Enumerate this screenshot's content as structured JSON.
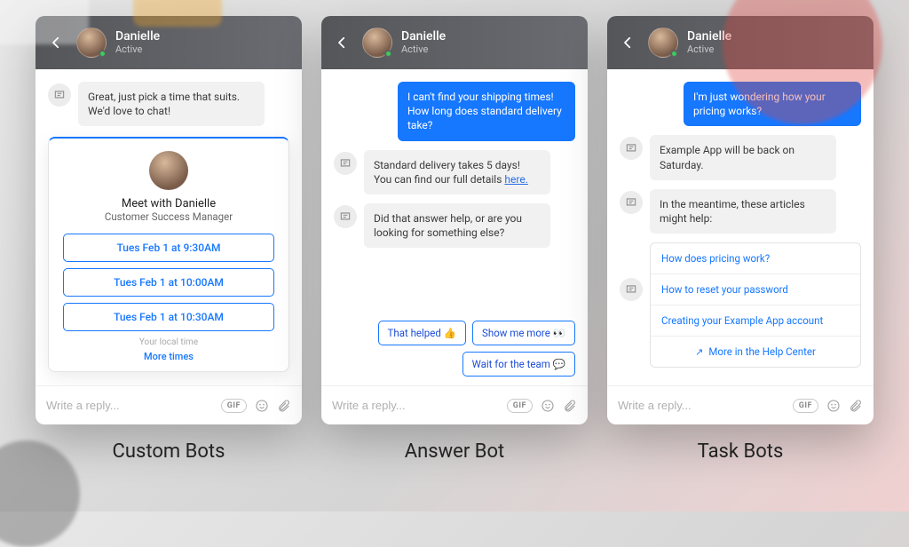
{
  "agent": {
    "name": "Danielle",
    "status": "Active"
  },
  "composer_placeholder": "Write a reply...",
  "composer_gif": "GIF",
  "panels": {
    "custom": {
      "caption": "Custom Bots",
      "bot_msg": "Great, just pick a time that suits. We'd love to chat!",
      "card": {
        "title": "Meet with Danielle",
        "subtitle": "Customer Success Manager",
        "slots": [
          "Tues Feb 1 at 9:30AM",
          "Tues Feb 1 at 10:00AM",
          "Tues Feb 1 at 10:30AM"
        ],
        "tz_note": "Your local time",
        "more": "More times"
      }
    },
    "answer": {
      "caption": "Answer Bot",
      "user_msg": "I can't find your shipping times! How long does standard delivery take?",
      "bot1_pre": "Standard delivery takes 5 days! You can find our full details ",
      "bot1_link": "here.",
      "bot2": "Did that answer help, or are you looking for something else?",
      "quick_replies": {
        "helped": "That helped 👍",
        "more": "Show me more 👀",
        "wait": "Wait for the team 💬"
      }
    },
    "task": {
      "caption": "Task Bots",
      "user_msg": "I'm just wondering how your pricing works?",
      "bot1": "Example App will be back on Saturday.",
      "bot2": "In the meantime, these articles might help:",
      "articles": [
        "How does pricing work?",
        "How to reset your password",
        "Creating your Example App account"
      ],
      "more": "More in the Help Center"
    }
  }
}
